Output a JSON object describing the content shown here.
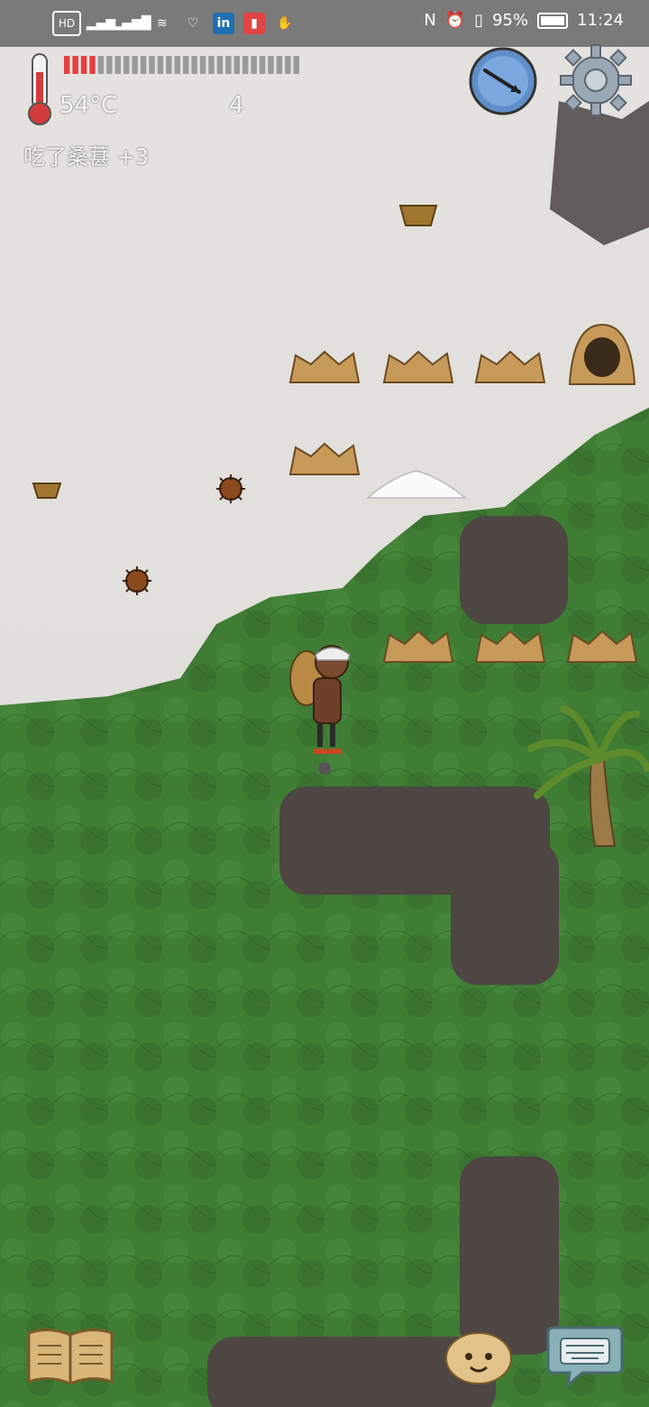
{
  "status_bar": {
    "left_icons": [
      "hd-icon",
      "signal-x-icon",
      "signal-4g-icon",
      "wifi-icon",
      "heart-icon",
      "linkedin-icon",
      "book-app-icon",
      "glove-icon"
    ],
    "nfc": "N",
    "battery_percent": "95%",
    "time": "11:24"
  },
  "hud": {
    "temperature": "54°C",
    "count": "4",
    "message": "吃了桑葚 +3",
    "health_fraction": 0.14
  },
  "colors": {
    "snow": "#e4e2de",
    "forest": "#3f7d34",
    "dirt": "#4d4642",
    "bar_red": "#e34040"
  },
  "icons": {
    "compass": "compass-icon",
    "settings": "gear-icon",
    "book": "book-icon",
    "emote": "potato-face-icon",
    "keyboard": "keyboard-icon"
  }
}
